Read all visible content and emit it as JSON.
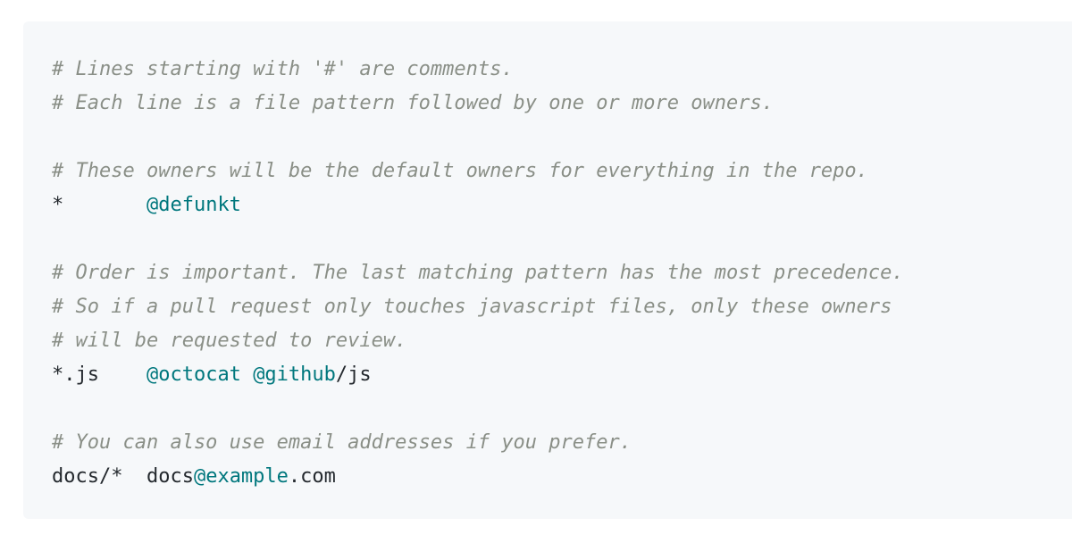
{
  "colors": {
    "background": "#f6f8fa",
    "comment": "#8a8f87",
    "owner": "#00777d",
    "text": "#24292e"
  },
  "code": {
    "comment_1": "# Lines starting with '#' are comments.",
    "comment_2": "# Each line is a file pattern followed by one or more owners.",
    "comment_3": "# These owners will be the default owners for everything in the repo.",
    "rule_1_pattern": "*       ",
    "rule_1_owner": "@defunkt",
    "comment_4": "# Order is important. The last matching pattern has the most precedence.",
    "comment_5": "# So if a pull request only touches javascript files, only these owners",
    "comment_6": "# will be requested to review.",
    "rule_2_pattern": "*.js    ",
    "rule_2_owner_1": "@octocat",
    "rule_2_space": " ",
    "rule_2_owner_2": "@github",
    "rule_2_owner_2_suffix": "/js",
    "comment_7": "# You can also use email addresses if you prefer.",
    "rule_3_pattern": "docs/*  ",
    "rule_3_email_user": "docs",
    "rule_3_email_domain": "@example",
    "rule_3_email_tld": ".com"
  }
}
